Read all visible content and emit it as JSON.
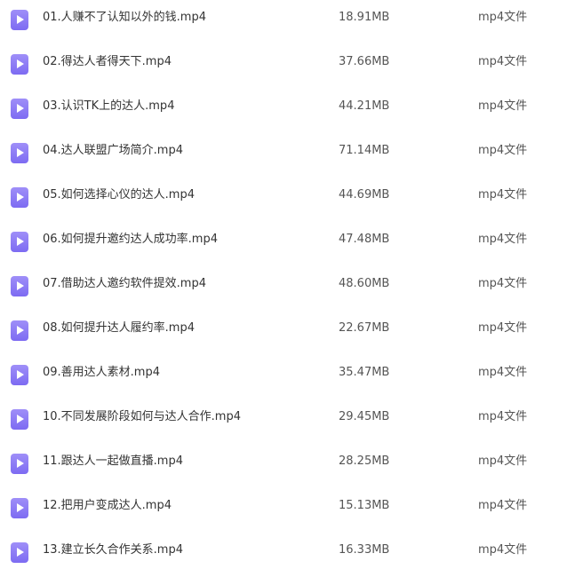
{
  "files": [
    {
      "icon": "video-file-icon",
      "name": "01.人赚不了认知以外的钱.mp4",
      "size": "18.91MB",
      "type": "mp4文件"
    },
    {
      "icon": "video-file-icon",
      "name": "02.得达人者得天下.mp4",
      "size": "37.66MB",
      "type": "mp4文件"
    },
    {
      "icon": "video-file-icon",
      "name": "03.认识TK上的达人.mp4",
      "size": "44.21MB",
      "type": "mp4文件"
    },
    {
      "icon": "video-file-icon",
      "name": "04.达人联盟广场简介.mp4",
      "size": "71.14MB",
      "type": "mp4文件"
    },
    {
      "icon": "video-file-icon",
      "name": "05.如何选择心仪的达人.mp4",
      "size": "44.69MB",
      "type": "mp4文件"
    },
    {
      "icon": "video-file-icon",
      "name": "06.如何提升邀约达人成功率.mp4",
      "size": "47.48MB",
      "type": "mp4文件"
    },
    {
      "icon": "video-file-icon",
      "name": "07.借助达人邀约软件提效.mp4",
      "size": "48.60MB",
      "type": "mp4文件"
    },
    {
      "icon": "video-file-icon",
      "name": "08.如何提升达人履约率.mp4",
      "size": "22.67MB",
      "type": "mp4文件"
    },
    {
      "icon": "video-file-icon",
      "name": "09.善用达人素材.mp4",
      "size": "35.47MB",
      "type": "mp4文件"
    },
    {
      "icon": "video-file-icon",
      "name": "10.不同发展阶段如何与达人合作.mp4",
      "size": "29.45MB",
      "type": "mp4文件"
    },
    {
      "icon": "video-file-icon",
      "name": "11.跟达人一起做直播.mp4",
      "size": "28.25MB",
      "type": "mp4文件"
    },
    {
      "icon": "video-file-icon",
      "name": "12.把用户变成达人.mp4",
      "size": "15.13MB",
      "type": "mp4文件"
    },
    {
      "icon": "video-file-icon",
      "name": "13.建立长久合作关系.mp4",
      "size": "16.33MB",
      "type": "mp4文件"
    }
  ],
  "colors": {
    "icon_accent": "#8a78f5",
    "text_primary": "#333333",
    "text_secondary": "#555555"
  }
}
